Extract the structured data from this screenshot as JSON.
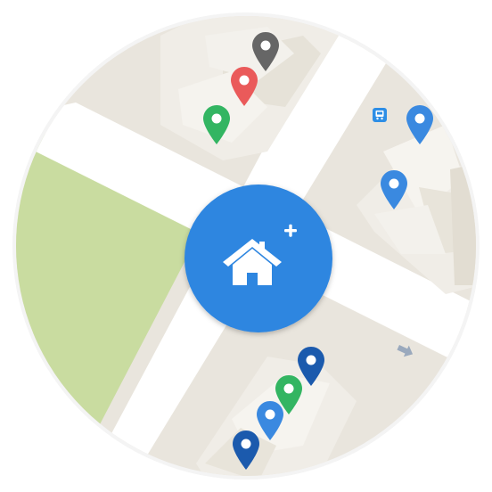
{
  "map": {
    "shape": "circle",
    "colors": {
      "ground": "#e9e5dd",
      "road": "#ffffff",
      "park": "#c9dca0",
      "building": "#efece6",
      "building_shadow": "#dcd7cd"
    }
  },
  "action_button": {
    "icon": "add-home-icon",
    "color": "#2f86e0",
    "icon_color": "#ffffff"
  },
  "pins": [
    {
      "name": "map-pin-gray",
      "color": "#666666"
    },
    {
      "name": "map-pin-red",
      "color": "#ea5a5a"
    },
    {
      "name": "map-pin-green",
      "color": "#33b562"
    },
    {
      "name": "map-pin-blue-1",
      "color": "#3a89e0"
    },
    {
      "name": "map-pin-blue-2",
      "color": "#3a89e0"
    },
    {
      "name": "map-pin-dark-blue-1",
      "color": "#1b5aad"
    },
    {
      "name": "map-pin-green-2",
      "color": "#33b562"
    },
    {
      "name": "map-pin-blue-3",
      "color": "#3a89e0"
    },
    {
      "name": "map-pin-dark-blue-2",
      "color": "#1b5aad"
    }
  ],
  "poi": {
    "icon": "bus-stop-icon",
    "color": "#2d8ee6"
  },
  "direction_arrow": {
    "icon": "arrow-icon",
    "color": "#9aa9bd"
  }
}
